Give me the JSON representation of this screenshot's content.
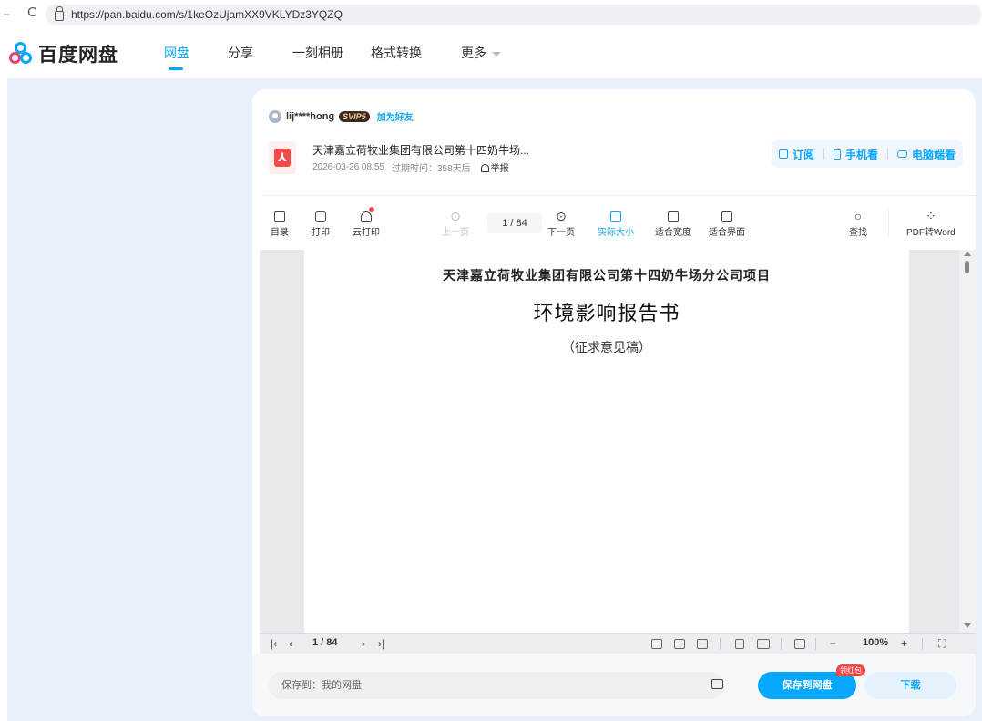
{
  "browser": {
    "url": "https://pan.baidu.com/s/1keOzUjamXX9VKLYDz3YQZQ"
  },
  "header": {
    "logo_text": "百度网盘",
    "nav": [
      "网盘",
      "分享",
      "一刻相册",
      "格式转换",
      "更多"
    ],
    "active_nav": "网盘",
    "accent": "#06a7ff"
  },
  "sharer": {
    "name": "lij****hong",
    "badge": "SVIP5",
    "add_friend": "加为好友"
  },
  "file": {
    "name": "天津嘉立荷牧业集团有限公司第十四奶牛场...",
    "date": "2026-03-26 08:55",
    "expire": "过期时间：358天后",
    "report": "举报",
    "type_icon": "pdf-icon"
  },
  "actions": [
    "订阅",
    "手机看",
    "电脑端看"
  ],
  "toolbar": {
    "toc": "目录",
    "print": "打印",
    "cloud_print": "云打印",
    "prev": "上一页",
    "page_current": "1",
    "page_total": "84",
    "page_display": "1 / 84",
    "next": "下一页",
    "actual_size": "实际大小",
    "fit_width": "适合宽度",
    "fit_page": "适合界面",
    "find": "查找",
    "pdf_to_word": "PDF转Word"
  },
  "document": {
    "subtitle": "天津嘉立荷牧业集团有限公司第十四奶牛场分公司项目",
    "title": "环境影响报告书",
    "draft": "（征求意见稿）"
  },
  "bottom_nav": {
    "page": "1 / 84",
    "zoom": "100%"
  },
  "savebar": {
    "save_to": "保存到：我的网盘",
    "save_button": "保存到网盘",
    "red_packet": "领红包",
    "download": "下载"
  }
}
